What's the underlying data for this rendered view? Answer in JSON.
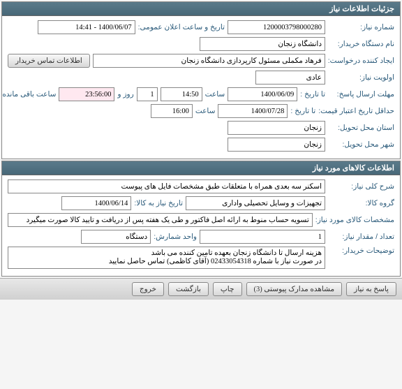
{
  "panel1": {
    "title": "جزئیات اطلاعات نیاز",
    "labels": {
      "need_no": "شماره نیاز:",
      "announce_date": "تاریخ و ساعت اعلان عمومی:",
      "buyer_name": "نام دستگاه خریدار:",
      "requester": "ایجاد کننده درخواست:",
      "contact_btn": "اطلاعات تماس خریدار",
      "priority": "اولویت نیاز:",
      "deadline": "مهلت ارسال پاسخ:",
      "to_date": "تا تاریخ :",
      "hour": "ساعت",
      "day_and": "روز و",
      "remaining": "ساعت باقی مانده",
      "validity": "حداقل تاریخ اعتبار قیمت:",
      "province": "استان محل تحویل:",
      "city": "شهر محل تحویل:"
    },
    "values": {
      "need_no": "1200003798000280",
      "announce_date": "1400/06/07 - 14:41",
      "buyer_name": "دانشگاه زنجان",
      "requester": "فرهاد مکملی مسئول کارپردازی دانشگاه زنجان",
      "priority": "عادی",
      "deadline_date": "1400/06/09",
      "deadline_hour": "14:50",
      "days": "1",
      "remaining_time": "23:56:00",
      "validity_date": "1400/07/28",
      "validity_hour": "16:00",
      "province": "زنجان",
      "city": "زنجان"
    }
  },
  "panel2": {
    "title": "اطلاعات کالاهای مورد نیاز",
    "labels": {
      "desc": "شرح کلی نیاز:",
      "group": "گروه کالا:",
      "need_date": "تاریخ نیاز به کالا:",
      "spec": "مشخصات کالای مورد نیاز:",
      "qty": "تعداد / مقدار نیاز:",
      "unit": "واحد شمارش:",
      "buyer_notes": "توضیحات خریدار:"
    },
    "values": {
      "desc": "اسکنر سه بعدی همراه با متعلقات طبق مشخصات فایل های پیوست",
      "group": "تجهیزات و وسایل تحصیلی واداری",
      "need_date": "1400/06/14",
      "spec": "تسویه حساب منوط به ارائه اصل فاکتور و طی یک هفته پس از دریافت و تایید کالا صورت میگیرد",
      "qty": "1",
      "unit": "دستگاه",
      "buyer_notes": "هزینه ارسال تا دانشگاه زنجان بعهده تامین کننده می باشد\nدر صورت نیاز با شماره 02433054318 (آقای کاظمی) تماس حاصل نمایید"
    }
  },
  "buttons": {
    "reply": "پاسخ به نیاز",
    "attachments": "مشاهده مدارک پیوستی (3)",
    "print": "چاپ",
    "back": "بازگشت",
    "exit": "خروج"
  }
}
